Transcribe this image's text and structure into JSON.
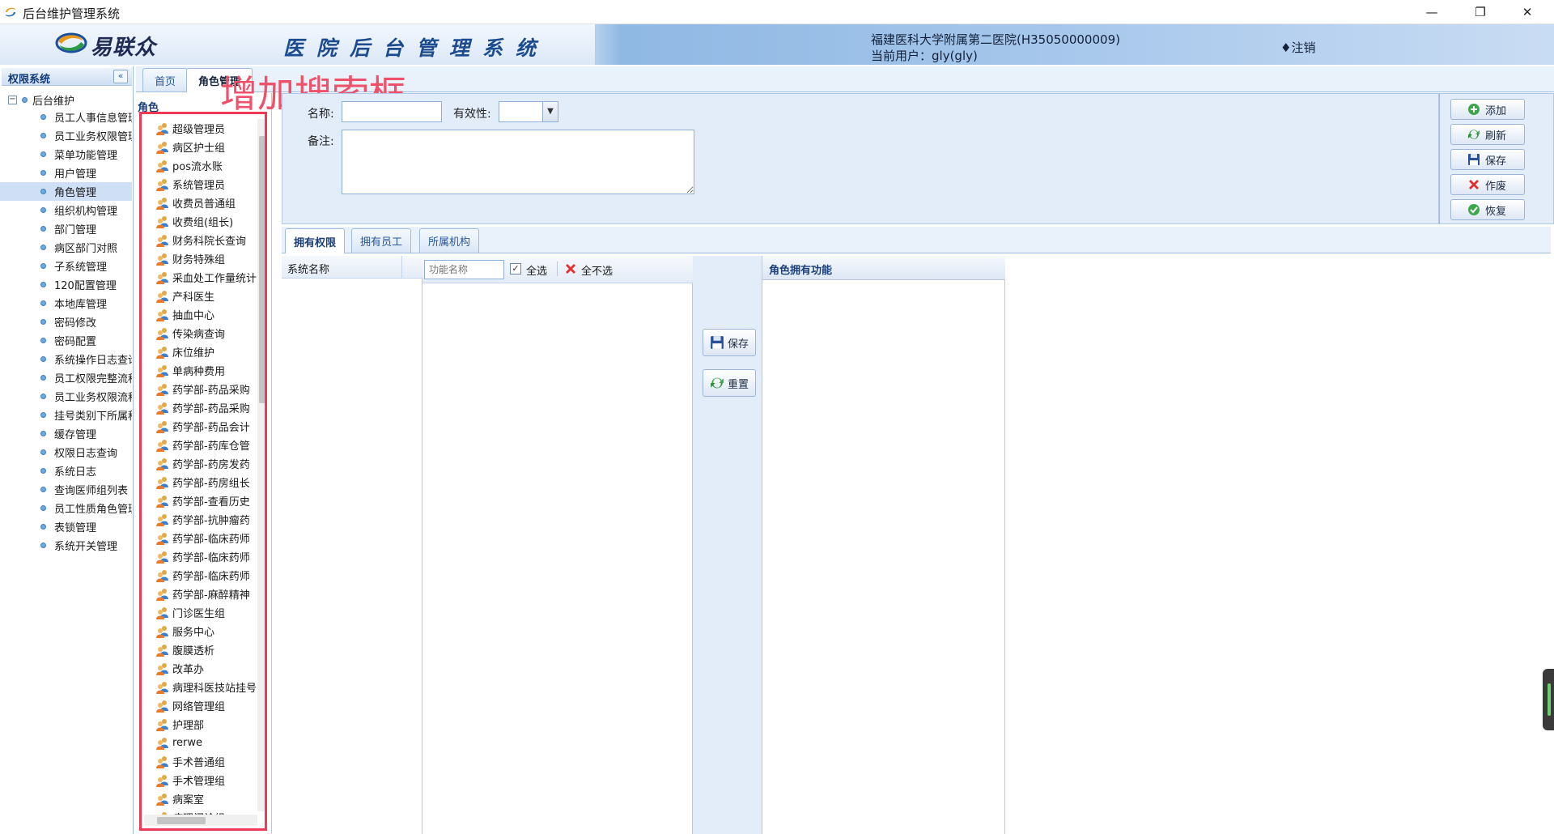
{
  "window": {
    "title": "后台维护管理系统",
    "controls": {
      "minimize": "—",
      "restore": "❐",
      "close": "✕"
    }
  },
  "header": {
    "brand": "易联众",
    "system_title": "医院后台管理系统",
    "hospital": "福建医科大学附属第二医院(H35050000009)",
    "current_user": "当前用户：gly(gly)",
    "logout": "♦注销"
  },
  "nav": {
    "title": "权限系统",
    "collapse_glyph": "«",
    "root": "后台维护",
    "items": [
      "员工人事信息管理",
      "员工业务权限管理",
      "菜单功能管理",
      "用户管理",
      "角色管理",
      "组织机构管理",
      "部门管理",
      "病区部门对照",
      "子系统管理",
      "120配置管理",
      "本地库管理",
      "密码修改",
      "密码配置",
      "系统操作日志查询",
      "员工权限完整流程",
      "员工业务权限流程",
      "挂号类别下所属科室",
      "缓存管理",
      "权限日志查询",
      "系统日志",
      "查询医师组列表",
      "员工性质角色管理",
      "表锁管理",
      "系统开关管理"
    ],
    "selected": "角色管理"
  },
  "tabs": {
    "home": "首页",
    "role": "角色管理"
  },
  "annotation": "增加搜索框",
  "roles": {
    "header": "角色",
    "items": [
      "超级管理员",
      "病区护士组",
      "pos流水账",
      "系统管理员",
      "收费员普通组",
      "收费组(组长)",
      "财务科院长查询",
      "财务特殊组",
      "采血处工作量统计",
      "产科医生",
      "抽血中心",
      "传染病查询",
      "床位维护",
      "单病种费用",
      "药学部-药品采购",
      "药学部-药品采购",
      "药学部-药品会计",
      "药学部-药库仓管",
      "药学部-药房发药",
      "药学部-药房组长",
      "药学部-查看历史",
      "药学部-抗肿瘤药",
      "药学部-临床药师",
      "药学部-临床药师",
      "药学部-临床药师",
      "药学部-麻醉精神",
      "门诊医生组",
      "服务中心",
      "腹膜透析",
      "改革办",
      "病理科医技站挂号",
      "网络管理组",
      "护理部",
      "rerwe",
      "手术普通组",
      "手术管理组",
      "病案室",
      "病理门诊组"
    ]
  },
  "form": {
    "name_label": "名称:",
    "name_value": "",
    "validity_label": "有效性:",
    "validity_value": "",
    "remark_label": "备注:",
    "remark_value": ""
  },
  "toolbar": {
    "add": "添加",
    "refresh": "刷新",
    "save": "保存",
    "void": "作废",
    "restore": "恢复"
  },
  "subtabs": {
    "permissions": "拥有权限",
    "staff": "拥有员工",
    "org": "所属机构"
  },
  "permissions": {
    "system_name_header": "系统名称",
    "function_search_placeholder": "功能名称",
    "select_all": "全选",
    "select_all_checked": true,
    "check_glyph": "✓",
    "select_none": "全不选",
    "save": "保存",
    "reset": "重置",
    "owned_functions_header": "角色拥有功能"
  }
}
